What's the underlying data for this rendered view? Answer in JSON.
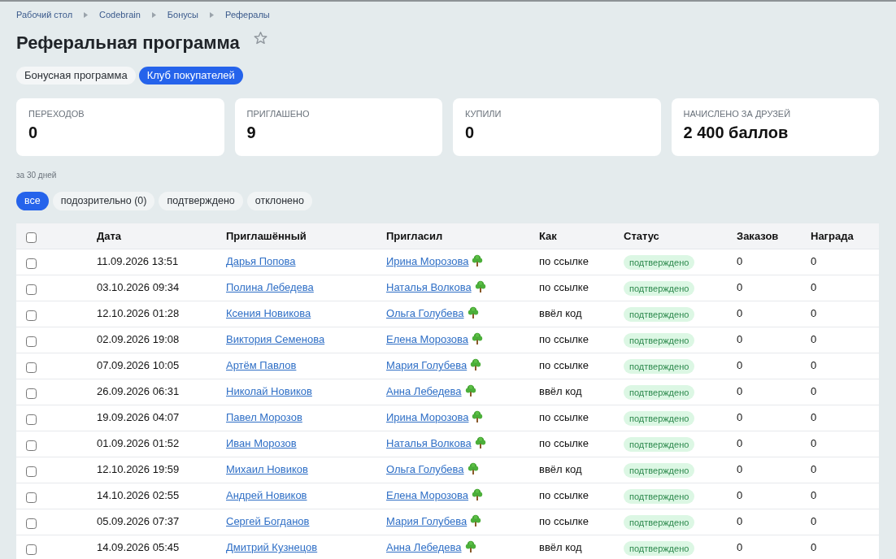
{
  "breadcrumbs": [
    "Рабочий стол",
    "Codebrain",
    "Бонусы",
    "Рефералы"
  ],
  "title": "Реферальная программа",
  "starred": false,
  "tabs": [
    {
      "label": "Бонусная программа",
      "selected": false
    },
    {
      "label": "Клуб покупателей",
      "selected": true
    }
  ],
  "stats": [
    {
      "label": "ПЕРЕХОДОВ",
      "value": "0"
    },
    {
      "label": "ПРИГЛАШЕНО",
      "value": "9"
    },
    {
      "label": "КУПИЛИ",
      "value": "0"
    },
    {
      "label": "НАЧИСЛЕНО ЗА ДРУЗЕЙ",
      "value": "2 400 баллов"
    }
  ],
  "period_note": "за 30 дней",
  "filters": [
    {
      "label": "все",
      "selected": true
    },
    {
      "label": "подозрительно (0)",
      "selected": false
    },
    {
      "label": "подтверждено",
      "selected": false
    },
    {
      "label": "отклонено",
      "selected": false
    }
  ],
  "table": {
    "select_all_checked": false,
    "columns": [
      "Дата",
      "Приглашённый",
      "Пригласил",
      "Как",
      "Статус",
      "Заказов",
      "Награда"
    ],
    "rows": [
      {
        "checked": false,
        "date": "11.09.2026 13:51",
        "invitee": "Дарья Попова",
        "inviter": "Ирина Морозова",
        "method": "по ссылке",
        "status": "подтверждено",
        "orders": "0",
        "reward": "0"
      },
      {
        "checked": false,
        "date": "03.10.2026 09:34",
        "invitee": "Полина Лебедева",
        "inviter": "Наталья Волкова",
        "method": "по ссылке",
        "status": "подтверждено",
        "orders": "0",
        "reward": "0"
      },
      {
        "checked": false,
        "date": "12.10.2026 01:28",
        "invitee": "Ксения Новикова",
        "inviter": "Ольга Голубева",
        "method": "ввёл код",
        "status": "подтверждено",
        "orders": "0",
        "reward": "0"
      },
      {
        "checked": false,
        "date": "02.09.2026 19:08",
        "invitee": "Виктория Семенова",
        "inviter": "Елена Морозова",
        "method": "по ссылке",
        "status": "подтверждено",
        "orders": "0",
        "reward": "0"
      },
      {
        "checked": false,
        "date": "07.09.2026 10:05",
        "invitee": "Артём Павлов",
        "inviter": "Мария Голубева",
        "method": "по ссылке",
        "status": "подтверждено",
        "orders": "0",
        "reward": "0"
      },
      {
        "checked": false,
        "date": "26.09.2026 06:31",
        "invitee": "Николай Новиков",
        "inviter": "Анна Лебедева",
        "method": "ввёл код",
        "status": "подтверждено",
        "orders": "0",
        "reward": "0"
      },
      {
        "checked": false,
        "date": "19.09.2026 04:07",
        "invitee": "Павел Морозов",
        "inviter": "Ирина Морозова",
        "method": "по ссылке",
        "status": "подтверждено",
        "orders": "0",
        "reward": "0"
      },
      {
        "checked": false,
        "date": "01.09.2026 01:52",
        "invitee": "Иван Морозов",
        "inviter": "Наталья Волкова",
        "method": "по ссылке",
        "status": "подтверждено",
        "orders": "0",
        "reward": "0"
      },
      {
        "checked": false,
        "date": "12.10.2026 19:59",
        "invitee": "Михаил Новиков",
        "inviter": "Ольга Голубева",
        "method": "ввёл код",
        "status": "подтверждено",
        "orders": "0",
        "reward": "0"
      },
      {
        "checked": false,
        "date": "14.10.2026 02:55",
        "invitee": "Андрей Новиков",
        "inviter": "Елена Морозова",
        "method": "по ссылке",
        "status": "подтверждено",
        "orders": "0",
        "reward": "0"
      },
      {
        "checked": false,
        "date": "05.09.2026 07:37",
        "invitee": "Сергей Богданов",
        "inviter": "Мария Голубева",
        "method": "по ссылке",
        "status": "подтверждено",
        "orders": "0",
        "reward": "0"
      },
      {
        "checked": false,
        "date": "14.09.2026 05:45",
        "invitee": "Дмитрий Кузнецов",
        "inviter": "Анна Лебедева",
        "method": "ввёл код",
        "status": "подтверждено",
        "orders": "0",
        "reward": "0"
      }
    ]
  }
}
